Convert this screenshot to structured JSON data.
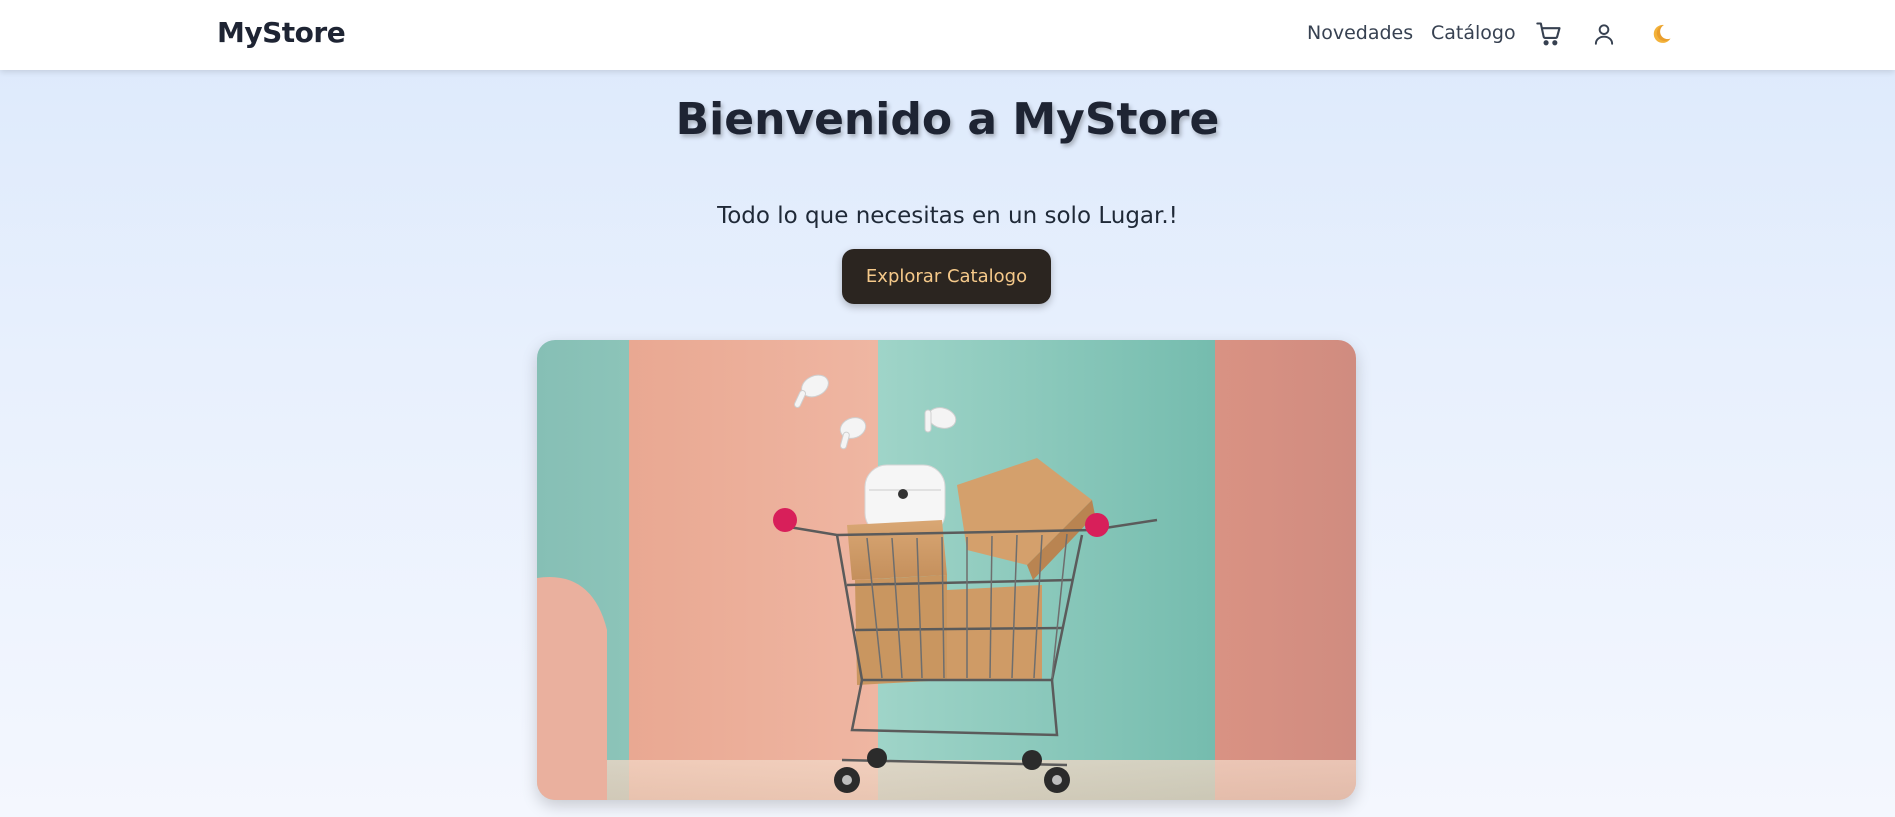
{
  "navbar": {
    "brand": "MyStore",
    "links": [
      {
        "label": "Novedades"
      },
      {
        "label": "Catálogo"
      }
    ],
    "icons": [
      "cart-icon",
      "user-icon",
      "moon-icon"
    ]
  },
  "hero": {
    "title": "Bienvenido a MyStore",
    "subtitle": "Todo lo que necesitas en un solo Lugar.!",
    "cta_label": "Explorar Catalogo",
    "image_alt": "shopping-cart-with-boxes-and-earbuds"
  },
  "colors": {
    "navbar_bg": "#ffffff",
    "brand_text": "#1e2433",
    "cta_bg": "#2b2520",
    "cta_text": "#f5c98a",
    "page_bg_top": "#dce9fc",
    "page_bg_bottom": "#f4f7fe"
  }
}
